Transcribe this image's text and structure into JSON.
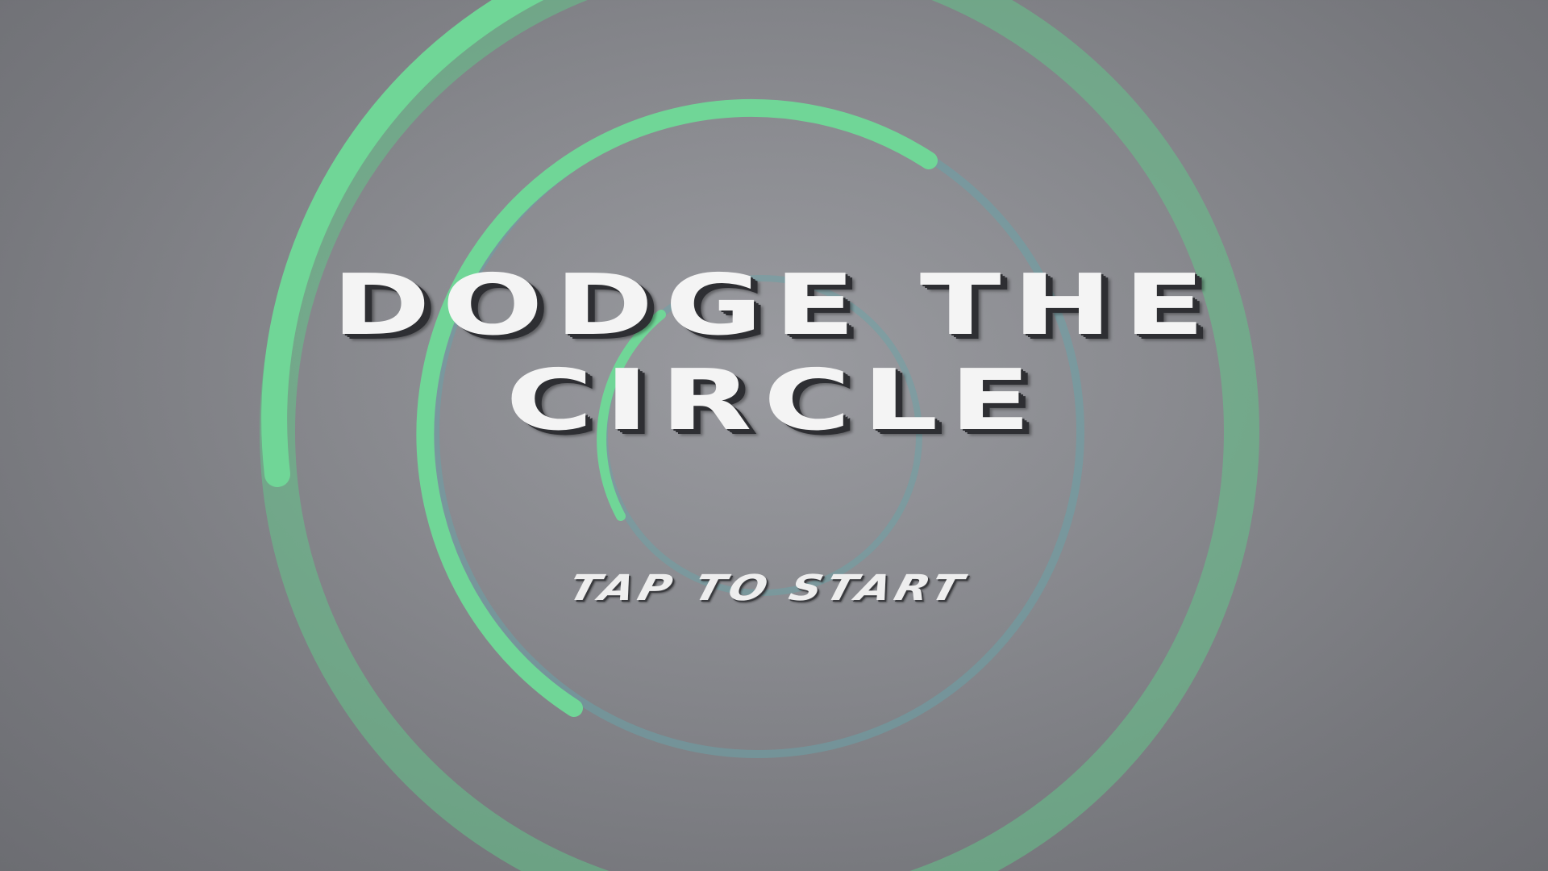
{
  "title": {
    "line1": "DODGE THE",
    "line2": "CIRCLE"
  },
  "prompt": "TAP TO START",
  "colors": {
    "background": "#8a8b90",
    "ring_green": "#6fd394",
    "ring_green_faded": "#62c98c",
    "ring_teal": "#6aa3a8",
    "title_text": "#f4f4f4",
    "title_shadow": "#2e2f33"
  }
}
